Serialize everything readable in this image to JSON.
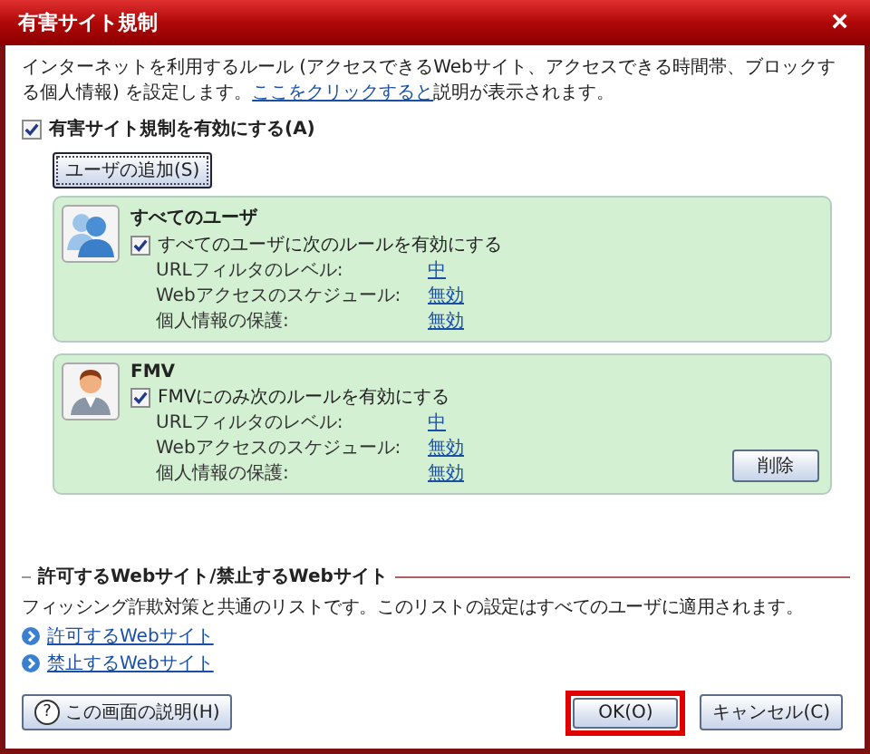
{
  "window": {
    "title": "有害サイト規制",
    "close": "×"
  },
  "intro": {
    "text": "インターネットを利用するルール (アクセスできるWebサイト、アクセスできる時間帯、ブロックする個人情報) を設定します。",
    "link": "ここをクリックすると",
    "after": "説明が表示されます。"
  },
  "enable": {
    "label": "有害サイト規制を有効にする(A)",
    "checked": true
  },
  "add_user_button": "ユーザの追加(S)",
  "users": [
    {
      "kind": "group",
      "name": "すべてのユーザ",
      "rule": {
        "label": "すべてのユーザに次のルールを有効にする",
        "checked": true
      },
      "settings": [
        {
          "label": "URLフィルタのレベル:",
          "value": "中"
        },
        {
          "label": "Webアクセスのスケジュール:",
          "value": "無効"
        },
        {
          "label": "個人情報の保護:",
          "value": "無効"
        }
      ]
    },
    {
      "kind": "person",
      "name": "FMV",
      "rule": {
        "label": "FMVにのみ次のルールを有効にする",
        "checked": true
      },
      "settings": [
        {
          "label": "URLフィルタのレベル:",
          "value": "中"
        },
        {
          "label": "Webアクセスのスケジュール:",
          "value": "無効"
        },
        {
          "label": "個人情報の保護:",
          "value": "無効"
        }
      ],
      "delete_button": "削除"
    }
  ],
  "sites": {
    "heading": "許可するWebサイト/禁止するWebサイト",
    "description": "フィッシング詐欺対策と共通のリストです。このリストの設定はすべてのユーザに適用されます。",
    "links": [
      "許可するWebサイト",
      "禁止するWebサイト"
    ]
  },
  "help_button": {
    "icon": "?",
    "label": "この画面の説明(H)"
  },
  "buttons": [
    {
      "label": "OK(O)",
      "highlighted": true
    },
    {
      "label": "キャンセル(C)",
      "highlighted": false
    }
  ]
}
